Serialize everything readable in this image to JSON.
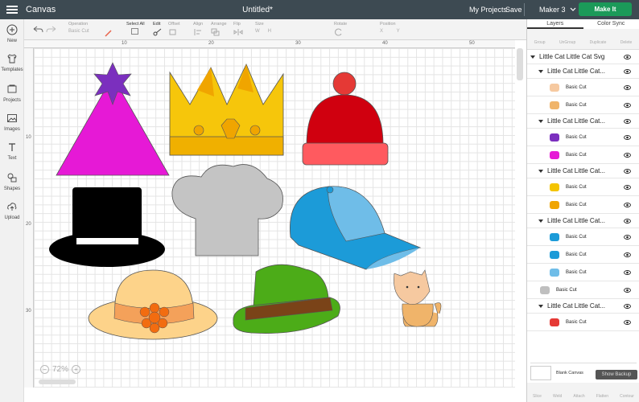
{
  "topbar": {
    "app_title": "Canvas",
    "doc_title": "Untitled*",
    "my_projects": "My Projects",
    "save": "Save",
    "machine": "Maker 3",
    "make_it": "Make It"
  },
  "toolbar": {
    "operation_label": "Operation",
    "operation_value": "Basic Cut",
    "select_all": "Select All",
    "edit": "Edit",
    "offset": "Offset",
    "align": "Align",
    "arrange": "Arrange",
    "flip": "Flip",
    "size": "Size",
    "rotate": "Rotate",
    "position": "Position"
  },
  "sidebar": [
    {
      "label": "New",
      "icon": "plus-icon"
    },
    {
      "label": "Templates",
      "icon": "shirt-icon"
    },
    {
      "label": "Projects",
      "icon": "folder-icon"
    },
    {
      "label": "Images",
      "icon": "image-icon"
    },
    {
      "label": "Text",
      "icon": "text-icon"
    },
    {
      "label": "Shapes",
      "icon": "shapes-icon"
    },
    {
      "label": "Upload",
      "icon": "upload-icon"
    }
  ],
  "rulers": {
    "top": [
      "10",
      "20",
      "30",
      "40",
      "50"
    ],
    "left": [
      "10",
      "20",
      "30"
    ]
  },
  "zoom": {
    "value": "72%"
  },
  "panel": {
    "tabs": [
      "Layers",
      "Color Sync"
    ],
    "tools": [
      "Group",
      "UnGroup",
      "Duplicate",
      "Delete"
    ],
    "root_layer": "Little Cat Little Cat Svg",
    "groups": [
      {
        "name": "Little Cat Little Cat...",
        "rows": [
          {
            "label": "Basic Cut",
            "color": "#f6c9a0"
          },
          {
            "label": "Basic Cut",
            "color": "#f0b46a"
          }
        ]
      },
      {
        "name": "Little Cat Little Cat...",
        "rows": [
          {
            "label": "Basic Cut",
            "color": "#7b2fbe"
          },
          {
            "label": "Basic Cut",
            "color": "#e619d6"
          }
        ]
      },
      {
        "name": "Little Cat Little Cat...",
        "rows": [
          {
            "label": "Basic Cut",
            "color": "#f4c400"
          },
          {
            "label": "Basic Cut",
            "color": "#f0a500"
          }
        ]
      },
      {
        "name": "Little Cat Little Cat...",
        "rows": [
          {
            "label": "Basic Cut",
            "color": "#1c9bd8"
          },
          {
            "label": "Basic Cut",
            "color": "#1c9bd8"
          },
          {
            "label": "Basic Cut",
            "color": "#6fbde8"
          }
        ]
      }
    ],
    "single_row": {
      "label": "Basic Cut",
      "color": "#bfbfbf"
    },
    "last_group": {
      "name": "Little Cat Little Cat...",
      "rows": [
        {
          "label": "Basic Cut",
          "color": "#e53935"
        }
      ]
    },
    "blank_canvas": "Blank Canvas",
    "bottom_tools": [
      "Slice",
      "Weld",
      "Attach",
      "Flatten",
      "Contour"
    ],
    "show_backup": "Show Backup"
  }
}
